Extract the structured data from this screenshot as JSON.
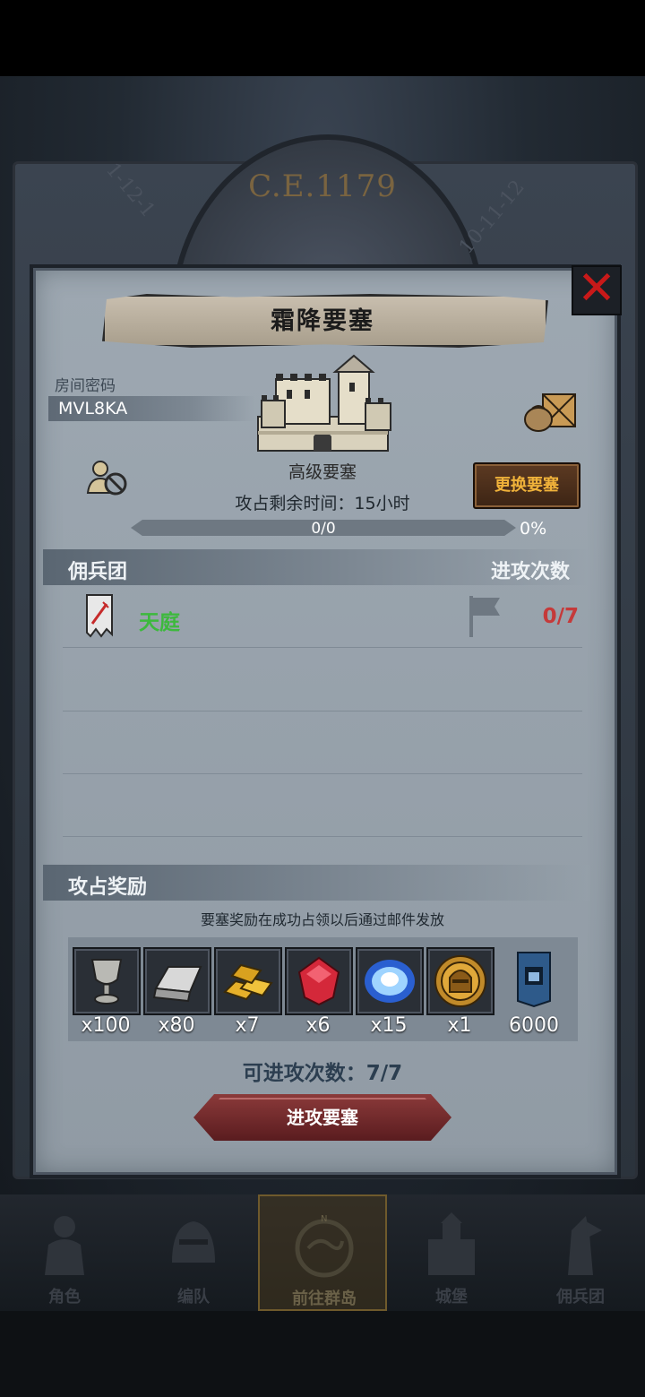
{
  "background": {
    "era": "C.E.1179",
    "wheel_left": "1-12-1",
    "wheel_right": "10-11-12"
  },
  "dialog": {
    "title": "霜降要塞",
    "room_label": "房间密码",
    "room_code": "MVL8KA",
    "fortress_grade": "高级要塞",
    "change_button": "更换要塞",
    "time_remaining": "攻占剩余时间：15小时",
    "progress": {
      "text": "0/0",
      "percent": "0%",
      "fraction": 0
    },
    "mercenary_header": "佣兵团",
    "attack_count_header": "进攻次数",
    "guilds": [
      {
        "name": "天庭",
        "attacks": "0/7"
      }
    ],
    "reward_header": "攻占奖励",
    "reward_notice": "要塞奖励在成功占领以后通过邮件发放",
    "rewards": [
      {
        "icon": "goblet-icon",
        "qty": "x100"
      },
      {
        "icon": "silver-ingot-icon",
        "qty": "x80"
      },
      {
        "icon": "gold-bars-icon",
        "qty": "x7"
      },
      {
        "icon": "ruby-icon",
        "qty": "x6"
      },
      {
        "icon": "crystal-orb-icon",
        "qty": "x15"
      },
      {
        "icon": "knight-medal-icon",
        "qty": "x1"
      },
      {
        "icon": "guild-banner-icon",
        "qty": "6000"
      }
    ],
    "attacks_left": "可进攻次数：7/7",
    "attack_button": "进攻要塞"
  },
  "nav": {
    "items": [
      {
        "label": "角色",
        "icon": "knight-icon"
      },
      {
        "label": "编队",
        "icon": "helmet-icon"
      },
      {
        "label": "前往群岛",
        "icon": "compass-map-icon",
        "active": true
      },
      {
        "label": "城堡",
        "icon": "castle-icon"
      },
      {
        "label": "佣兵团",
        "icon": "mercenary-icon"
      }
    ]
  },
  "colors": {
    "panel": "#98a3ad",
    "close": "#c81919",
    "accent_gold": "#f0b23a",
    "guild_green": "#3db93d",
    "attack_red": "#c53a3a",
    "button_red": "#8b3a3a"
  }
}
